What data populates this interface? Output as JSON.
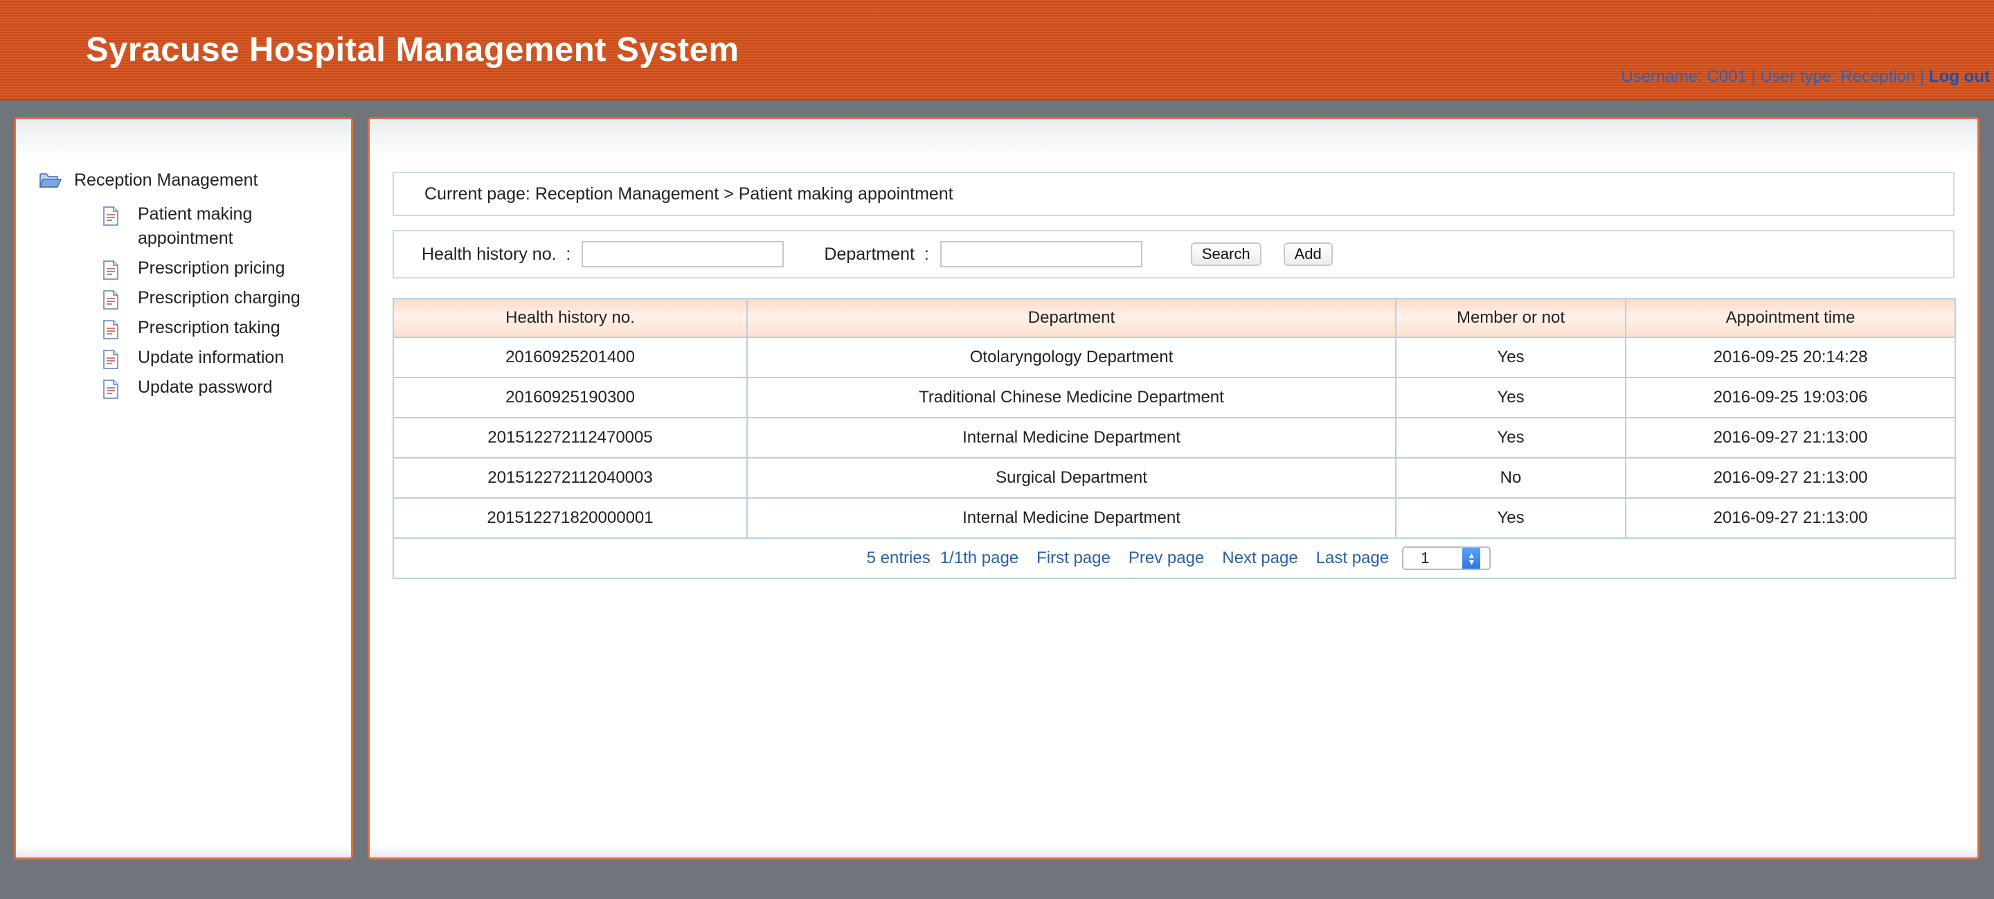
{
  "header": {
    "title": "Syracuse Hospital Management System",
    "user_info": "Username: C001 | User type: Reception | ",
    "logout_label": "Log out"
  },
  "sidebar": {
    "root_label": "Reception Management",
    "root_icon": "folder-open-icon",
    "items": [
      {
        "label": "Patient making appointment",
        "icon": "document-icon"
      },
      {
        "label": "Prescription pricing",
        "icon": "document-icon"
      },
      {
        "label": "Prescription charging",
        "icon": "document-icon"
      },
      {
        "label": "Prescription taking",
        "icon": "document-icon"
      },
      {
        "label": "Update information",
        "icon": "document-icon"
      },
      {
        "label": "Update password",
        "icon": "document-icon"
      }
    ]
  },
  "breadcrumb": {
    "text": "Current page: Reception Management > Patient making appointment"
  },
  "search": {
    "health_label": "Health history no.  :",
    "health_value": "",
    "department_label": "Department  :",
    "department_value": "",
    "search_button": "Search",
    "add_button": "Add"
  },
  "table": {
    "columns": [
      "Health history no.",
      "Department",
      "Member or not",
      "Appointment time"
    ],
    "rows": [
      [
        "20160925201400",
        "Otolaryngology Department",
        "Yes",
        "2016-09-25 20:14:28"
      ],
      [
        "20160925190300",
        "Traditional Chinese Medicine Department",
        "Yes",
        "2016-09-25 19:03:06"
      ],
      [
        "201512272112470005",
        "Internal Medicine Department",
        "Yes",
        "2016-09-27 21:13:00"
      ],
      [
        "201512272112040003",
        "Surgical Department",
        "No",
        "2016-09-27 21:13:00"
      ],
      [
        "201512271820000001",
        "Internal Medicine Department",
        "Yes",
        "2016-09-27 21:13:00"
      ]
    ]
  },
  "pager": {
    "entries": "5 entries",
    "page_info": "1/1th page",
    "first": "First page",
    "prev": "Prev page",
    "next": "Next page",
    "last": "Last page",
    "current_page": "1"
  },
  "colors": {
    "header": "#d4511b",
    "panel_border": "#e0703d",
    "background": "#6f757b",
    "link": "#2b5fa8"
  }
}
